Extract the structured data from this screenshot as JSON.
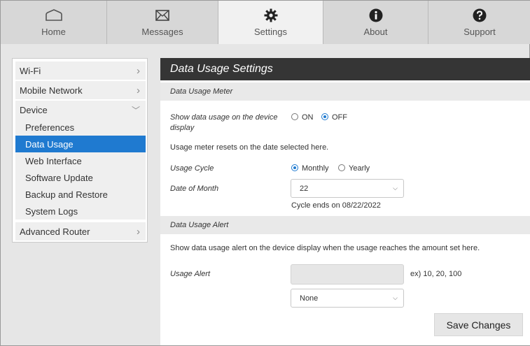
{
  "nav": {
    "tabs": [
      {
        "label": "Home",
        "icon": "home-icon"
      },
      {
        "label": "Messages",
        "icon": "envelope-icon"
      },
      {
        "label": "Settings",
        "icon": "gear-icon",
        "active": true
      },
      {
        "label": "About",
        "icon": "info-icon"
      },
      {
        "label": "Support",
        "icon": "question-icon"
      }
    ]
  },
  "sidebar": {
    "items": [
      {
        "label": "Wi-Fi",
        "chevron": "›"
      },
      {
        "label": "Mobile Network",
        "chevron": "›"
      },
      {
        "label": "Device",
        "chevron": "﹀"
      },
      {
        "label": "Advanced Router",
        "chevron": "›"
      }
    ],
    "device_subitems": [
      {
        "label": "Preferences"
      },
      {
        "label": "Data Usage",
        "selected": true
      },
      {
        "label": "Web Interface"
      },
      {
        "label": "Software Update"
      },
      {
        "label": "Backup and Restore"
      },
      {
        "label": "System Logs"
      }
    ]
  },
  "main": {
    "title": "Data Usage Settings",
    "meter": {
      "section_title": "Data Usage Meter",
      "show_label_line1": "Show data usage on the device",
      "show_label_line2": "display",
      "on_label": "ON",
      "off_label": "OFF",
      "selected": "OFF",
      "reset_note": "Usage meter resets on the date selected here.",
      "cycle_label": "Usage Cycle",
      "monthly_label": "Monthly",
      "yearly_label": "Yearly",
      "cycle_selected": "Monthly",
      "date_label": "Date of Month",
      "date_value": "22",
      "cycle_ends": "Cycle ends on 08/22/2022"
    },
    "alert": {
      "section_title": "Data Usage Alert",
      "description": "Show data usage alert on the device display when the usage reaches the amount set here.",
      "usage_alert_label": "Usage Alert",
      "usage_alert_value": "",
      "example_hint": "ex) 10, 20, 100",
      "unit_value": "None"
    },
    "save_label": "Save Changes"
  },
  "colors": {
    "accent": "#1f7ad0",
    "header_bg": "#353535",
    "nav_bg": "#d7d7d7"
  }
}
